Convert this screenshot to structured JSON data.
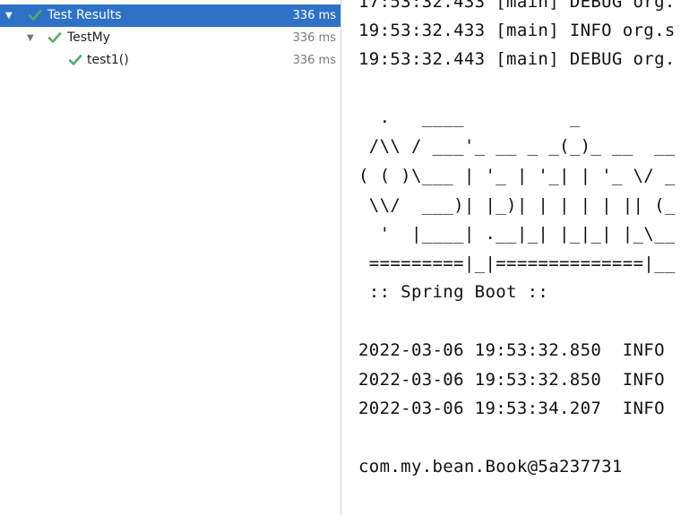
{
  "tree": {
    "items": [
      {
        "label": "Test Results",
        "time": "336 ms",
        "arrow": "▼",
        "status": "passed",
        "selected": true
      },
      {
        "label": "TestMy",
        "time": "336 ms",
        "arrow": "▼",
        "status": "passed",
        "selected": false
      },
      {
        "label": "test1()",
        "time": "336 ms",
        "arrow": "",
        "status": "passed",
        "selected": false
      }
    ]
  },
  "console": {
    "lines": [
      "17:53:32.433 [main] DEBUG org.",
      "19:53:32.433 [main] INFO org.s",
      "19:53:32.443 [main] DEBUG org.",
      "",
      "  .   ____          _",
      " /\\\\ / ___'_ __ _ _(_)_ __  __",
      "( ( )\\___ | '_ | '_| | '_ \\/ _",
      " \\\\/  ___)| |_)| | | | | || (_",
      "  '  |____| .__|_| |_|_| |_\\__",
      " =========|_|==============|__",
      " :: Spring Boot ::",
      "",
      "2022-03-06 19:53:32.850  INFO",
      "2022-03-06 19:53:32.850  INFO",
      "2022-03-06 19:53:34.207  INFO",
      "",
      "com.my.bean.Book@5a237731"
    ]
  },
  "colors": {
    "selection": "#2e72c8",
    "passed_check": "#59a869",
    "muted_text": "#7a7a7a",
    "splitter": "#d4d4d4"
  },
  "icons": {
    "passed": "check-icon",
    "expanded": "triangle-down-icon"
  }
}
